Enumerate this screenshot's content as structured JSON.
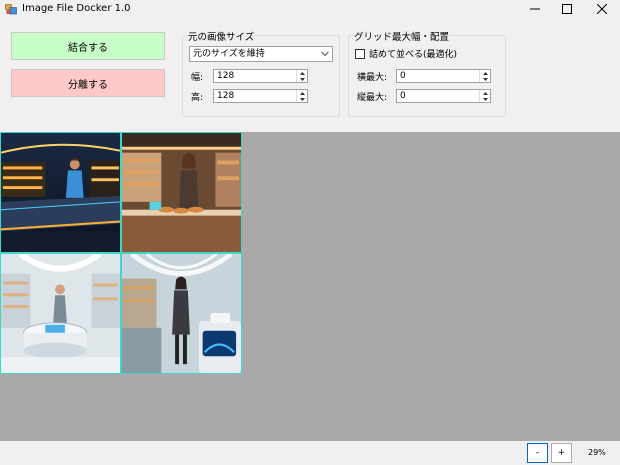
{
  "window": {
    "title": "Image File Docker 1.0"
  },
  "actions": {
    "combine_label": "結合する",
    "split_label": "分離する"
  },
  "size_group": {
    "legend": "元の画像サイズ",
    "mode_selected": "元のサイズを維持",
    "width_label": "幅:",
    "width_value": "128",
    "height_label": "高:",
    "height_value": "128"
  },
  "grid_group": {
    "legend": "グリッド最大幅・配置",
    "pack_label": "詰めて並べる(最適化)",
    "pack_checked": false,
    "cols_label": "横最大:",
    "cols_value": "0",
    "rows_label": "縦最大:",
    "rows_value": "0"
  },
  "status": {
    "zoom_minus": "-",
    "zoom_plus": "+",
    "zoom_level": "29%"
  },
  "colors": {
    "combine_bg": "#c8ffc8",
    "split_bg": "#ffc8c8",
    "tile_border": "#3fd6cc",
    "canvas_bg": "#a9a9a9"
  }
}
